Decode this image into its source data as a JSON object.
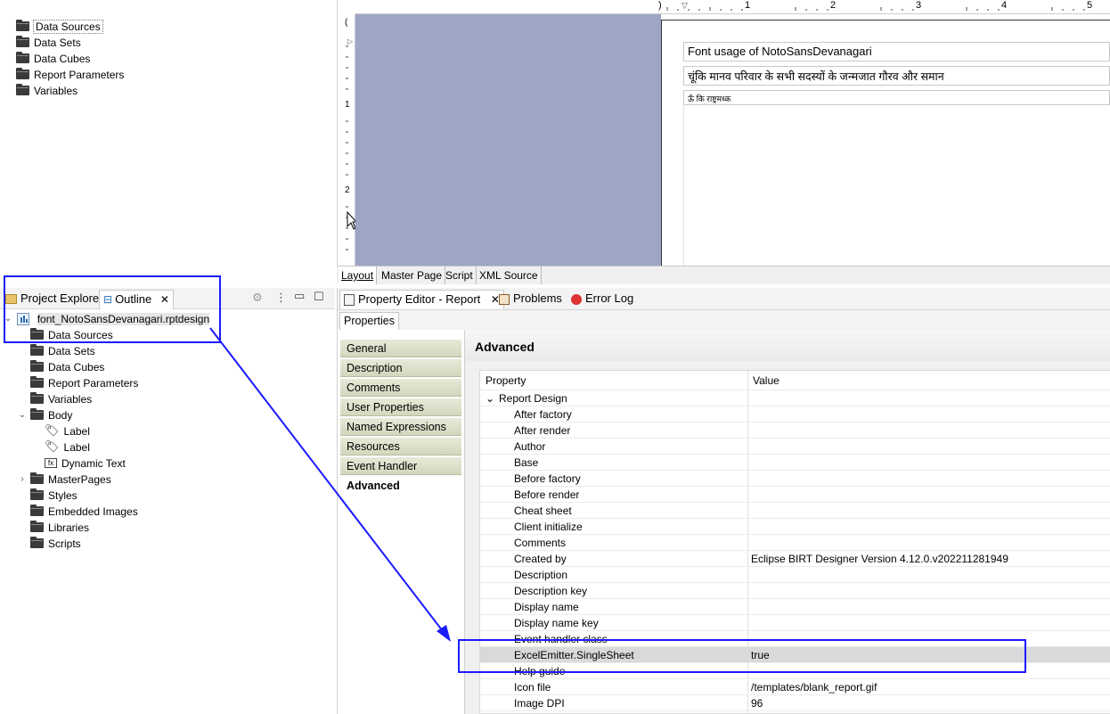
{
  "data_explorer": {
    "items": [
      "Data Sources",
      "Data Sets",
      "Data Cubes",
      "Report Parameters",
      "Variables"
    ]
  },
  "editor": {
    "ruler_top": [
      ")",
      "1",
      "2",
      "3",
      "4",
      "5"
    ],
    "ruler_left": [
      "(",
      "1",
      "2"
    ],
    "labels": [
      "Font usage of NotoSansDevanagari",
      "चूंकि मानव परिवार के सभी सदस्यों के जन्मजात गौरव और समान",
      "ऊँ कि राष्ट्रमध्क"
    ],
    "tabs": [
      "Layout",
      "Master Page",
      "Script",
      "XML Source"
    ]
  },
  "outline": {
    "tabs": [
      "Project Explorer",
      "Outline"
    ],
    "close_glyph": "✕",
    "root": "font_NotoSansDevanagari.rptdesign",
    "items": [
      {
        "label": "Data Sources",
        "icon": "folder-icon"
      },
      {
        "label": "Data Sets",
        "icon": "folder-icon"
      },
      {
        "label": "Data Cubes",
        "icon": "folder-icon"
      },
      {
        "label": "Report Parameters",
        "icon": "folder-icon"
      },
      {
        "label": "Variables",
        "icon": "folder-icon"
      },
      {
        "label": "Body",
        "icon": "folder-icon"
      },
      {
        "label": "Label",
        "icon": "label-tag-icon"
      },
      {
        "label": "Label",
        "icon": "label-tag-icon"
      },
      {
        "label": "Dynamic Text",
        "icon": "dynamic-text-icon"
      },
      {
        "label": "MasterPages",
        "icon": "folder-icon"
      },
      {
        "label": "Styles",
        "icon": "folder-icon"
      },
      {
        "label": "Embedded Images",
        "icon": "folder-icon"
      },
      {
        "label": "Libraries",
        "icon": "folder-icon"
      },
      {
        "label": "Scripts",
        "icon": "folder-icon"
      }
    ]
  },
  "property_editor": {
    "tabs": [
      "Property Editor - Report",
      "Problems",
      "Error Log"
    ],
    "close_glyph": "✕",
    "subtab": "Properties",
    "nav": [
      "General",
      "Description",
      "Comments",
      "User Properties",
      "Named Expressions",
      "Resources",
      "Event Handler",
      "Advanced"
    ],
    "active_nav": "Advanced",
    "section_title": "Advanced",
    "columns": [
      "Property",
      "Value"
    ],
    "group": "Report Design",
    "rows": [
      {
        "name": "After factory",
        "value": ""
      },
      {
        "name": "After render",
        "value": ""
      },
      {
        "name": "Author",
        "value": ""
      },
      {
        "name": "Base",
        "value": ""
      },
      {
        "name": "Before factory",
        "value": ""
      },
      {
        "name": "Before render",
        "value": ""
      },
      {
        "name": "Cheat sheet",
        "value": ""
      },
      {
        "name": "Client initialize",
        "value": ""
      },
      {
        "name": "Comments",
        "value": ""
      },
      {
        "name": "Created by",
        "value": "Eclipse BIRT Designer Version 4.12.0.v202211281949"
      },
      {
        "name": "Description",
        "value": ""
      },
      {
        "name": "Description key",
        "value": ""
      },
      {
        "name": "Display name",
        "value": ""
      },
      {
        "name": "Display name key",
        "value": ""
      },
      {
        "name": "Event handler class",
        "value": ""
      },
      {
        "name": "ExcelEmitter.SingleSheet",
        "value": "true"
      },
      {
        "name": "Help guide",
        "value": ""
      },
      {
        "name": "Icon file",
        "value": "/templates/blank_report.gif"
      },
      {
        "name": "Image DPI",
        "value": "96"
      }
    ],
    "selected_row": "ExcelEmitter.SingleSheet"
  },
  "colors": {
    "annotation": "#1b1bff",
    "canvas": "#9da6c4",
    "nav_gradient": "#d3d6bd"
  }
}
